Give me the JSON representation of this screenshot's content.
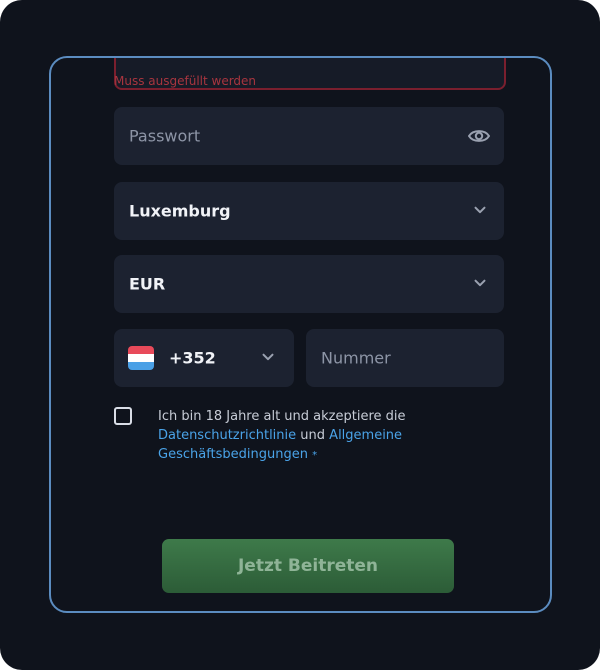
{
  "form": {
    "error_message": "Muss ausgefüllt werden",
    "password": {
      "placeholder": "Passwort",
      "icon": "eye-icon"
    },
    "country": {
      "value": "Luxemburg",
      "icon": "chevron-down-icon"
    },
    "currency": {
      "value": "EUR",
      "icon": "chevron-down-icon"
    },
    "phone": {
      "dial_code": "+352",
      "flag": "luxembourg-flag",
      "number_placeholder": "Nummer"
    },
    "consent": {
      "prefix": "Ich bin 18 Jahre alt und akzeptiere die",
      "privacy_link": "Datenschutzrichtlinie",
      "conjunction": "und",
      "terms_link_1": "Allgemeine",
      "terms_link_2": "Geschäftsbedingungen",
      "required_marker": "*"
    },
    "submit_label": "Jetzt Beitreten"
  },
  "colors": {
    "background": "#0f131c",
    "frame_border": "#5b8cc0",
    "field_bg": "#1c2230",
    "error": "#a8353f",
    "link": "#4aa3e8",
    "button": "#3e7a4a"
  }
}
